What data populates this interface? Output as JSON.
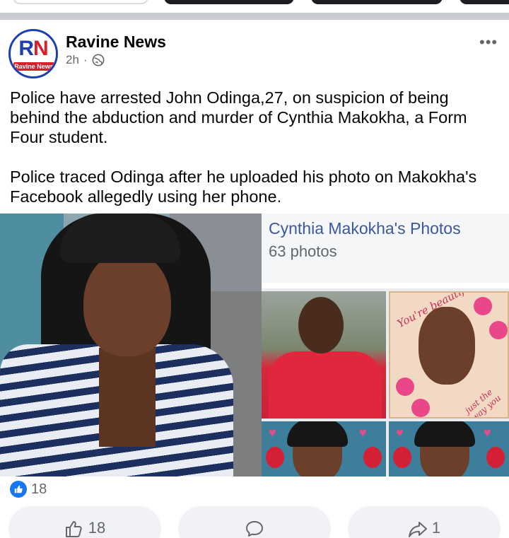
{
  "post": {
    "page_name": "Ravine News",
    "time": "2h",
    "separator": "·",
    "avatar_initials_r": "R",
    "avatar_initials_n": "N",
    "avatar_band": "Ravine News",
    "more_label": "•••",
    "caption_paragraphs": [
      "Police have arrested John Odinga,27, on suspicion of being behind the abduction and murder of Cynthia Makokha, a Form Four student.",
      "Police traced Odinga after he uploaded his photo on Makokha's Facebook allegedly using her phone."
    ]
  },
  "photo": {
    "album_title": "Cynthia Makokha's Photos",
    "album_count": "63 photos",
    "collage_text_1": "You're beautiful",
    "collage_text_2": "just the way you are"
  },
  "reactions": {
    "count": "18",
    "icon": "thumbs-up-icon",
    "color": "#1877f2"
  },
  "actions": {
    "like_count": "18",
    "like_icon": "thumbs-up-outline-icon",
    "comment_icon": "comment-icon",
    "share_count": "1",
    "share_icon": "share-arrow-icon"
  }
}
